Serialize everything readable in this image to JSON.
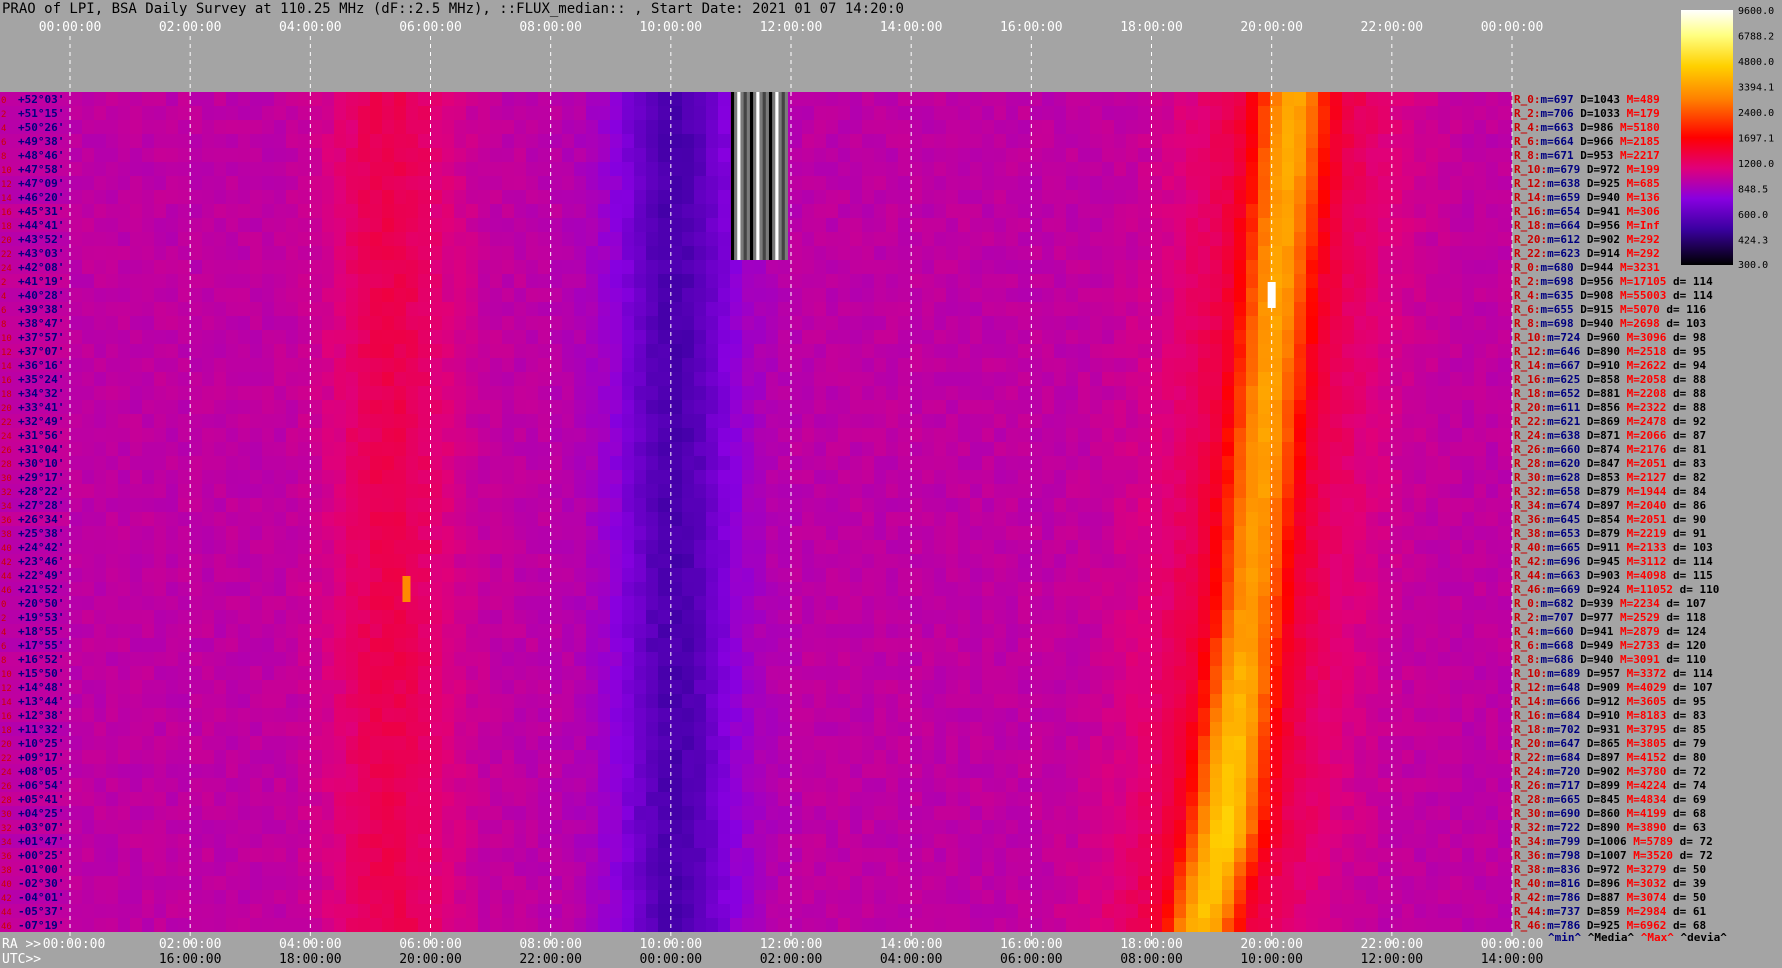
{
  "title": "PRAO of LPI, BSA Daily Survey at 110.25 MHz (dF::2.5 MHz), ::FLUX_median:: , Start Date: 2021 01 07 14:20:0",
  "colorbar": {
    "ticks": [
      "9600.0",
      "6788.2",
      "4800.0",
      "3394.1",
      "2400.0",
      "1697.1",
      "1200.0",
      "848.5",
      "600.0",
      "424.3",
      "300.0"
    ],
    "values": [
      9600.0,
      6788.2,
      4800.0,
      3394.1,
      2400.0,
      1697.1,
      1200.0,
      848.5,
      600.0,
      424.3,
      300.0
    ]
  },
  "axes": {
    "top_time_labels": [
      "00:00:00",
      "02:00:00",
      "04:00:00",
      "06:00:00",
      "08:00:00",
      "10:00:00",
      "12:00:00",
      "14:00:00",
      "16:00:00",
      "18:00:00",
      "20:00:00",
      "22:00:00",
      "00:00:00"
    ],
    "ra_prefix": "RA >>",
    "utc_prefix": "UTC>>",
    "bottom_ra_labels": [
      "00:00:00",
      "02:00:00",
      "04:00:00",
      "06:00:00",
      "08:00:00",
      "10:00:00",
      "12:00:00",
      "14:00:00",
      "16:00:00",
      "18:00:00",
      "20:00:00",
      "22:00:00",
      "00:00:00"
    ],
    "bottom_utc_labels": [
      "16:00:00",
      "18:00:00",
      "20:00:00",
      "22:00:00",
      "00:00:00",
      "02:00:00",
      "04:00:00",
      "06:00:00",
      "08:00:00",
      "10:00:00",
      "12:00:00",
      "14:00:00"
    ],
    "declinations": [
      "+52°03'",
      "+51°15'",
      "+50°26'",
      "+49°38'",
      "+48°46'",
      "+47°58'",
      "+47°09'",
      "+46°20'",
      "+45°31'",
      "+44°41'",
      "+43°52'",
      "+43°03'",
      "+42°08'",
      "+41°19'",
      "+40°28'",
      "+39°38'",
      "+38°47'",
      "+37°57'",
      "+37°07'",
      "+36°16'",
      "+35°24'",
      "+34°32'",
      "+33°41'",
      "+32°49'",
      "+31°56'",
      "+31°04'",
      "+30°10'",
      "+29°17'",
      "+28°22'",
      "+27°28'",
      "+26°34'",
      "+25°38'",
      "+24°42'",
      "+23°46'",
      "+22°49'",
      "+21°52'",
      "+20°50'",
      "+19°53'",
      "+18°55'",
      "+17°55'",
      "+16°52'",
      "+15°50'",
      "+14°48'",
      "+13°44'",
      "+12°38'",
      "+11°32'",
      "+10°25'",
      "+09°17'",
      "+08°05'",
      "+06°54'",
      "+05°41'",
      "+04°25'",
      "+03°07'",
      "+01°47'",
      "+00°25'",
      "-01°00'",
      "-02°30'",
      "-04°01'",
      "-05°37'",
      "-07°19'"
    ],
    "ray_index_labels": [
      "0",
      "2",
      "4",
      "6",
      "8",
      "10",
      "12",
      "14",
      "16",
      "18",
      "20",
      "22",
      "24",
      "2",
      "4",
      "6",
      "8",
      "10",
      "12",
      "14",
      "16",
      "18",
      "20",
      "22",
      "24",
      "26",
      "28",
      "30",
      "32",
      "34",
      "36",
      "38",
      "40",
      "42",
      "44",
      "46",
      "0",
      "2",
      "4",
      "6",
      "8",
      "10",
      "12",
      "14",
      "16",
      "18",
      "20",
      "22",
      "24",
      "26",
      "28",
      "30",
      "32",
      "34",
      "36",
      "38",
      "40",
      "42",
      "44",
      "46"
    ]
  },
  "stats": [
    {
      "label": "R_0:",
      "min": "697",
      "med": "1043",
      "max": "489",
      "devia": ""
    },
    {
      "label": "R_2:",
      "min": "706",
      "med": "1033",
      "max": "179",
      "devia": ""
    },
    {
      "label": "R_4:",
      "min": "663",
      "med": "986",
      "max": "5180",
      "devia": ""
    },
    {
      "label": "R_6:",
      "min": "664",
      "med": "966",
      "max": "2185",
      "devia": ""
    },
    {
      "label": "R_8:",
      "min": "671",
      "med": "953",
      "max": "2217",
      "devia": ""
    },
    {
      "label": "R_10:",
      "min": "679",
      "med": "972",
      "max": "199",
      "devia": ""
    },
    {
      "label": "R_12:",
      "min": "638",
      "med": "925",
      "max": "685",
      "devia": ""
    },
    {
      "label": "R_14:",
      "min": "659",
      "med": "940",
      "max": "136",
      "devia": ""
    },
    {
      "label": "R_16:",
      "min": "654",
      "med": "941",
      "max": "306",
      "devia": ""
    },
    {
      "label": "R_18:",
      "min": "664",
      "med": "956",
      "max": "Inf",
      "devia": ""
    },
    {
      "label": "R_20:",
      "min": "612",
      "med": "902",
      "max": "292",
      "devia": ""
    },
    {
      "label": "R_22:",
      "min": "623",
      "med": "914",
      "max": "292",
      "devia": ""
    },
    {
      "label": "R_0:",
      "min": "680",
      "med": "944",
      "max": "3231",
      "devia": ""
    },
    {
      "label": "R_2:",
      "min": "698",
      "med": "956",
      "max": "17105",
      "devia": "114"
    },
    {
      "label": "R_4:",
      "min": "635",
      "med": "908",
      "max": "55003",
      "devia": "114"
    },
    {
      "label": "R_6:",
      "min": "655",
      "med": "915",
      "max": "5070",
      "devia": "116"
    },
    {
      "label": "R_8:",
      "min": "698",
      "med": "940",
      "max": "2698",
      "devia": "103"
    },
    {
      "label": "R_10:",
      "min": "724",
      "med": "960",
      "max": "3096",
      "devia": "98"
    },
    {
      "label": "R_12:",
      "min": "646",
      "med": "890",
      "max": "2518",
      "devia": "95"
    },
    {
      "label": "R_14:",
      "min": "667",
      "med": "910",
      "max": "2622",
      "devia": "94"
    },
    {
      "label": "R_16:",
      "min": "625",
      "med": "858",
      "max": "2058",
      "devia": "88"
    },
    {
      "label": "R_18:",
      "min": "652",
      "med": "881",
      "max": "2208",
      "devia": "88"
    },
    {
      "label": "R_20:",
      "min": "611",
      "med": "856",
      "max": "2322",
      "devia": "88"
    },
    {
      "label": "R_22:",
      "min": "621",
      "med": "869",
      "max": "2478",
      "devia": "92"
    },
    {
      "label": "R_24:",
      "min": "638",
      "med": "871",
      "max": "2066",
      "devia": "87"
    },
    {
      "label": "R_26:",
      "min": "660",
      "med": "874",
      "max": "2176",
      "devia": "81"
    },
    {
      "label": "R_28:",
      "min": "620",
      "med": "847",
      "max": "2051",
      "devia": "83"
    },
    {
      "label": "R_30:",
      "min": "628",
      "med": "853",
      "max": "2127",
      "devia": "82"
    },
    {
      "label": "R_32:",
      "min": "658",
      "med": "879",
      "max": "1944",
      "devia": "84"
    },
    {
      "label": "R_34:",
      "min": "674",
      "med": "897",
      "max": "2040",
      "devia": "86"
    },
    {
      "label": "R_36:",
      "min": "645",
      "med": "854",
      "max": "2051",
      "devia": "90"
    },
    {
      "label": "R_38:",
      "min": "653",
      "med": "879",
      "max": "2219",
      "devia": "91"
    },
    {
      "label": "R_40:",
      "min": "665",
      "med": "911",
      "max": "2133",
      "devia": "103"
    },
    {
      "label": "R_42:",
      "min": "696",
      "med": "945",
      "max": "3112",
      "devia": "114"
    },
    {
      "label": "R_44:",
      "min": "663",
      "med": "903",
      "max": "4098",
      "devia": "115"
    },
    {
      "label": "R_46:",
      "min": "669",
      "med": "924",
      "max": "11052",
      "devia": "110"
    },
    {
      "label": "R_0:",
      "min": "682",
      "med": "939",
      "max": "2234",
      "devia": "107"
    },
    {
      "label": "R_2:",
      "min": "707",
      "med": "977",
      "max": "2529",
      "devia": "118"
    },
    {
      "label": "R_4:",
      "min": "660",
      "med": "941",
      "max": "2879",
      "devia": "124"
    },
    {
      "label": "R_6:",
      "min": "668",
      "med": "949",
      "max": "2733",
      "devia": "120"
    },
    {
      "label": "R_8:",
      "min": "686",
      "med": "940",
      "max": "3091",
      "devia": "110"
    },
    {
      "label": "R_10:",
      "min": "689",
      "med": "957",
      "max": "3372",
      "devia": "114"
    },
    {
      "label": "R_12:",
      "min": "648",
      "med": "909",
      "max": "4029",
      "devia": "107"
    },
    {
      "label": "R_14:",
      "min": "666",
      "med": "912",
      "max": "3605",
      "devia": "95"
    },
    {
      "label": "R_16:",
      "min": "684",
      "med": "910",
      "max": "8183",
      "devia": "83"
    },
    {
      "label": "R_18:",
      "min": "702",
      "med": "931",
      "max": "3795",
      "devia": "85"
    },
    {
      "label": "R_20:",
      "min": "647",
      "med": "865",
      "max": "3805",
      "devia": "79"
    },
    {
      "label": "R_22:",
      "min": "684",
      "med": "897",
      "max": "4152",
      "devia": "80"
    },
    {
      "label": "R_24:",
      "min": "720",
      "med": "902",
      "max": "3780",
      "devia": "72"
    },
    {
      "label": "R_26:",
      "min": "717",
      "med": "899",
      "max": "4224",
      "devia": "74"
    },
    {
      "label": "R_28:",
      "min": "665",
      "med": "845",
      "max": "4834",
      "devia": "69"
    },
    {
      "label": "R_30:",
      "min": "690",
      "med": "860",
      "max": "4199",
      "devia": "68"
    },
    {
      "label": "R_32:",
      "min": "722",
      "med": "890",
      "max": "3890",
      "devia": "63"
    },
    {
      "label": "R_34:",
      "min": "799",
      "med": "1006",
      "max": "5789",
      "devia": "72"
    },
    {
      "label": "R_36:",
      "min": "798",
      "med": "1007",
      "max": "3520",
      "devia": "72"
    },
    {
      "label": "R_38:",
      "min": "836",
      "med": "972",
      "max": "3279",
      "devia": "50"
    },
    {
      "label": "R_40:",
      "min": "816",
      "med": "896",
      "max": "3032",
      "devia": "39"
    },
    {
      "label": "R_42:",
      "min": "786",
      "med": "887",
      "max": "3074",
      "devia": "50"
    },
    {
      "label": "R_44:",
      "min": "737",
      "med": "859",
      "max": "2984",
      "devia": "61"
    },
    {
      "label": "R_46:",
      "min": "786",
      "med": "925",
      "max": "6962",
      "devia": "68"
    }
  ],
  "stats_footer": {
    "min": "^min^",
    "med": "^Media^",
    "max": "^Max^",
    "devia": "^devia^"
  },
  "colors": {
    "background": "#a4a4a4",
    "stat_label": "#cc0000",
    "stat_min": "#000080",
    "stat_med": "#000000",
    "stat_max": "#ff0000",
    "ray_index": "#cc0000",
    "declination": "#000080"
  },
  "chart_data": {
    "type": "heatmap",
    "title": "PRAO of LPI, BSA Daily Survey at 110.25 MHz (dF::2.5 MHz), ::FLUX_median:: , Start Date: 2021 01 07 14:20:0",
    "xlabel": "RA",
    "ylabel": "",
    "x_range_hours": [
      0,
      24
    ],
    "rows": 60,
    "color_scale": "log",
    "value_range": [
      300.0,
      9600.0
    ],
    "features": [
      {
        "name": "Galactic plane band",
        "description": "bright diagonal ridge",
        "points": [
          {
            "ra_h": 20.0,
            "dec": "+43°03'",
            "flux": 3000
          },
          {
            "ra_h": 19.5,
            "dec": "+20°50'",
            "flux": 2800
          },
          {
            "ra_h": 19.1,
            "dec": "+03°07'",
            "flux": 4000
          },
          {
            "ra_h": 18.7,
            "dec": "-07°19'",
            "flux": 3500
          }
        ]
      },
      {
        "name": "Cyg A",
        "ra_h": 20.0,
        "dec": "+40°28'",
        "flux": 55003
      },
      {
        "name": "Tau A",
        "ra_h": 5.6,
        "dec": "+21°52'",
        "flux": 3000
      },
      {
        "name": "Cold sky region",
        "ra_h": 10.0,
        "dec": "+30°10'",
        "flux": 500
      }
    ]
  }
}
